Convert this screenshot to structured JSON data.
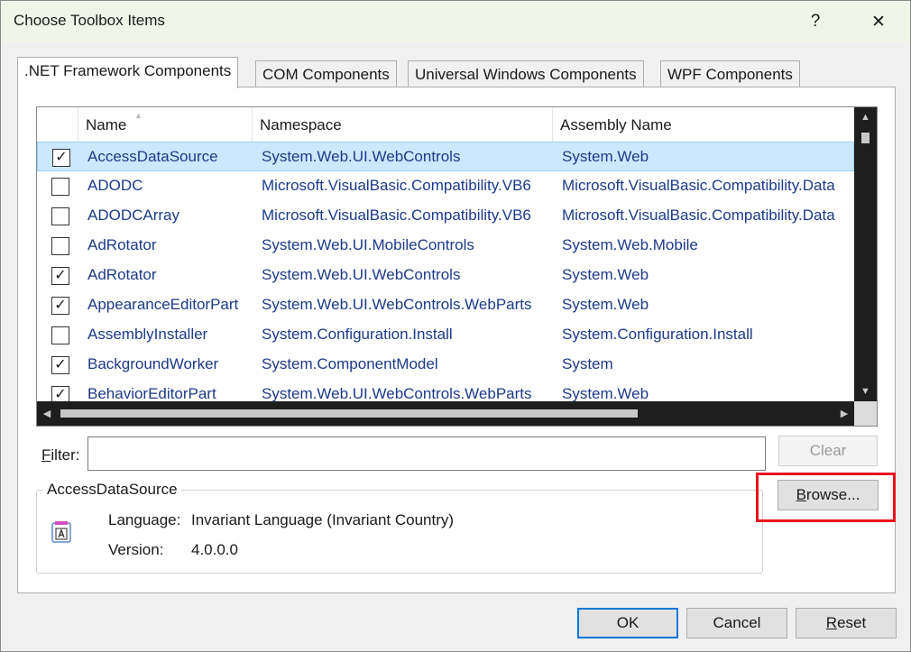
{
  "window": {
    "title": "Choose Toolbox Items",
    "help_glyph": "?",
    "close_glyph": "✕"
  },
  "tabs": [
    {
      "label": ".NET Framework Components",
      "active": true
    },
    {
      "label": "COM Components",
      "active": false
    },
    {
      "label": "Universal Windows Components",
      "active": false
    },
    {
      "label": "WPF Components",
      "active": false
    }
  ],
  "list": {
    "columns": {
      "name": "Name",
      "namespace": "Namespace",
      "assembly": "Assembly Name"
    },
    "rows": [
      {
        "checked": true,
        "name": "AccessDataSource",
        "namespace": "System.Web.UI.WebControls",
        "assembly": "System.Web",
        "selected": true
      },
      {
        "checked": false,
        "name": "ADODC",
        "namespace": "Microsoft.VisualBasic.Compatibility.VB6",
        "assembly": "Microsoft.VisualBasic.Compatibility.Data"
      },
      {
        "checked": false,
        "name": "ADODCArray",
        "namespace": "Microsoft.VisualBasic.Compatibility.VB6",
        "assembly": "Microsoft.VisualBasic.Compatibility.Data"
      },
      {
        "checked": false,
        "name": "AdRotator",
        "namespace": "System.Web.UI.MobileControls",
        "assembly": "System.Web.Mobile"
      },
      {
        "checked": true,
        "name": "AdRotator",
        "namespace": "System.Web.UI.WebControls",
        "assembly": "System.Web"
      },
      {
        "checked": true,
        "name": "AppearanceEditorPart",
        "namespace": "System.Web.UI.WebControls.WebParts",
        "assembly": "System.Web"
      },
      {
        "checked": false,
        "name": "AssemblyInstaller",
        "namespace": "System.Configuration.Install",
        "assembly": "System.Configuration.Install"
      },
      {
        "checked": true,
        "name": "BackgroundWorker",
        "namespace": "System.ComponentModel",
        "assembly": "System"
      },
      {
        "checked": true,
        "name": "BehaviorEditorPart",
        "namespace": "System.Web.UI.WebControls.WebParts",
        "assembly": "System.Web"
      }
    ]
  },
  "filter": {
    "label_mnemonic": "F",
    "label_rest": "ilter:",
    "value": "",
    "clear_label": "Clear"
  },
  "browse": {
    "mnemonic": "B",
    "rest": "rowse..."
  },
  "details": {
    "title": "AccessDataSource",
    "language_label": "Language:",
    "language_value": "Invariant Language (Invariant Country)",
    "version_label": "Version:",
    "version_value": "4.0.0.0"
  },
  "footer": {
    "ok_label": "OK",
    "cancel_label": "Cancel",
    "reset_mnemonic": "R",
    "reset_rest": "eset"
  },
  "colors": {
    "highlight": "#e8141e",
    "link_text": "#1c3a8a",
    "selection": "#cce8ff"
  }
}
